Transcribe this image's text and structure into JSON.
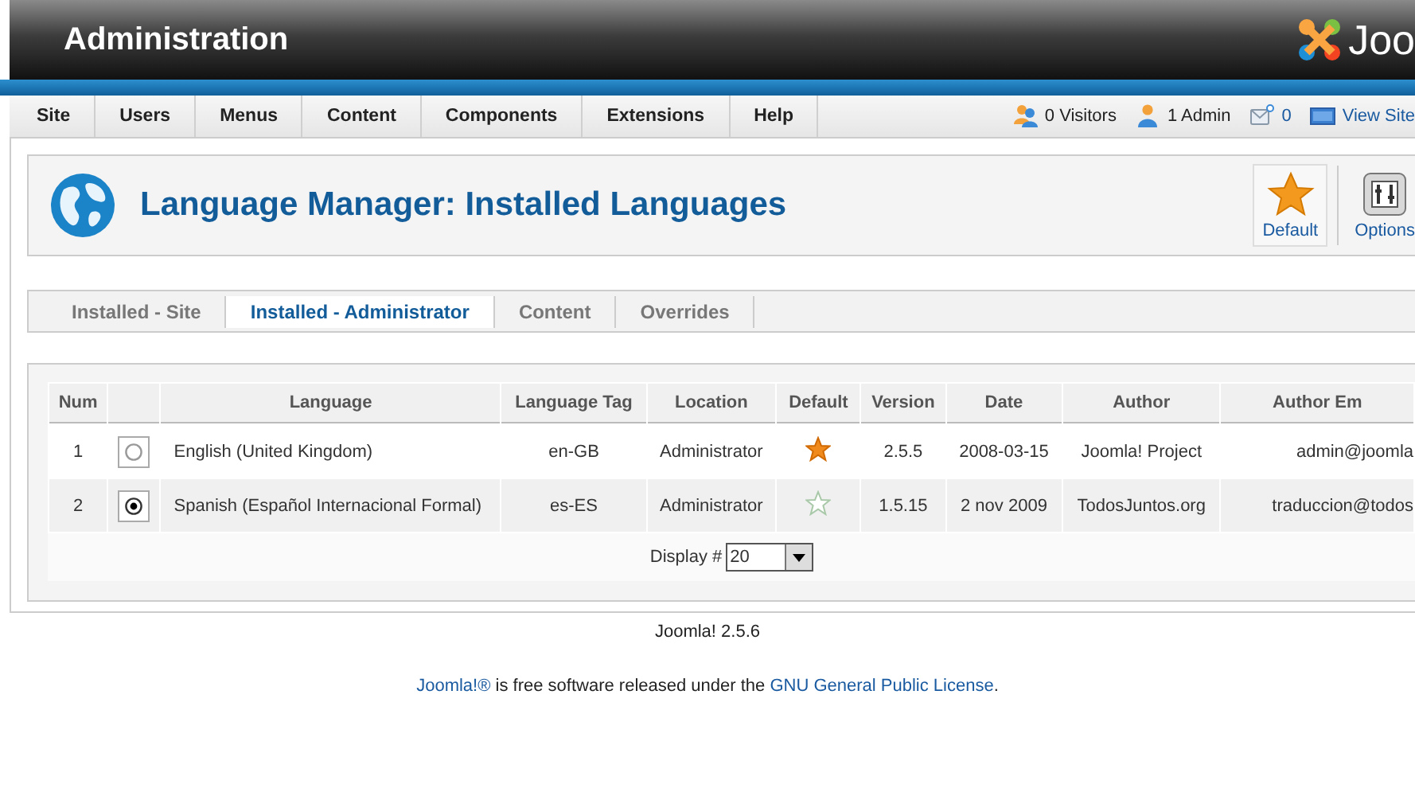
{
  "header": {
    "title": "Administration",
    "logo_text": "Joo"
  },
  "menu": {
    "items": [
      "Site",
      "Users",
      "Menus",
      "Content",
      "Components",
      "Extensions",
      "Help"
    ],
    "status": [
      {
        "kind": "visitors",
        "text": "0 Visitors"
      },
      {
        "kind": "admins",
        "text": "1 Admin"
      },
      {
        "kind": "messages",
        "text": "0"
      },
      {
        "kind": "site",
        "text": "View Site"
      }
    ]
  },
  "page": {
    "title": "Language Manager: Installed Languages",
    "toolbar": [
      {
        "kind": "default",
        "label": "Default"
      },
      {
        "kind": "options",
        "label": "Options"
      }
    ]
  },
  "subtabs": [
    {
      "label": "Installed - Site",
      "selected": false
    },
    {
      "label": "Installed - Administrator",
      "selected": true
    },
    {
      "label": "Content",
      "selected": false
    },
    {
      "label": "Overrides",
      "selected": false
    }
  ],
  "table": {
    "columns": [
      "Num",
      "Language",
      "Language Tag",
      "Location",
      "Default",
      "Version",
      "Date",
      "Author",
      "Author Em"
    ],
    "rows": [
      {
        "num": "1",
        "selected": false,
        "language": "English (United Kingdom)",
        "tag": "en-GB",
        "location": "Administrator",
        "default": true,
        "version": "2.5.5",
        "date": "2008-03-15",
        "author": "Joomla! Project",
        "email": "admin@joomla"
      },
      {
        "num": "2",
        "selected": true,
        "language": "Spanish (Español Internacional Formal)",
        "tag": "es-ES",
        "location": "Administrator",
        "default": false,
        "version": "1.5.15",
        "date": "2 nov 2009",
        "author": "TodosJuntos.org",
        "email": "traduccion@todos"
      }
    ],
    "pagination": {
      "label": "Display #",
      "value": "20"
    }
  },
  "footer": {
    "version": "Joomla! 2.5.6",
    "brand": "Joomla!®",
    "text": "is free software released under the",
    "license": "GNU General Public License",
    "end": "."
  }
}
